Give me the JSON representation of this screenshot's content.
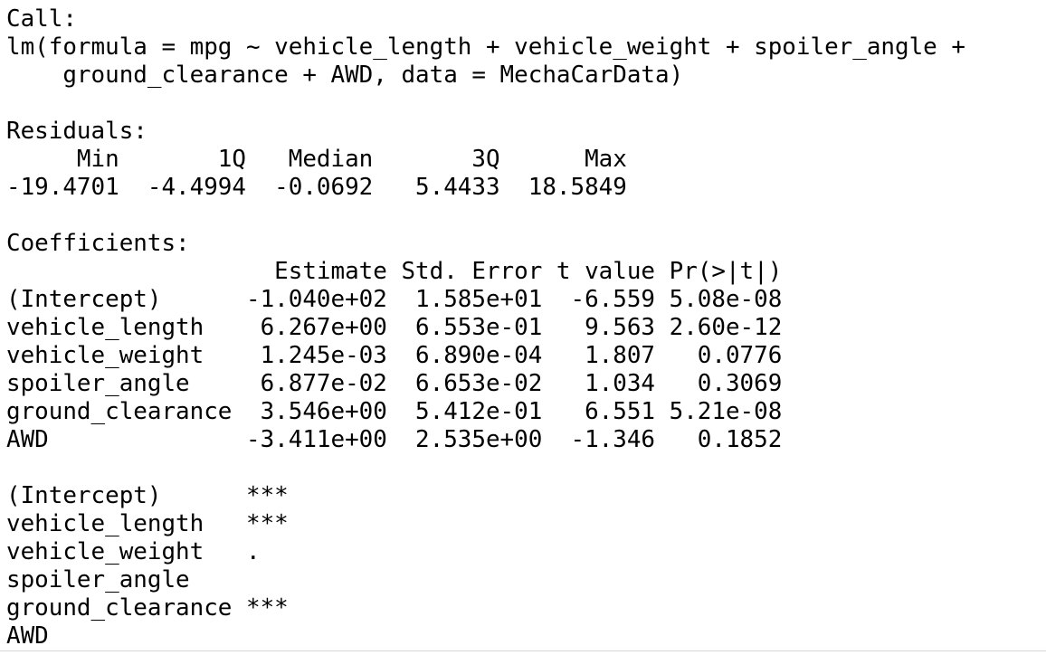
{
  "console": {
    "lines": [
      "Call:",
      "lm(formula = mpg ~ vehicle_length + vehicle_weight + spoiler_angle + ",
      "    ground_clearance + AWD, data = MechaCarData)",
      "",
      "Residuals:",
      "     Min       1Q   Median       3Q      Max ",
      "-19.4701  -4.4994  -0.0692   5.4433  18.5849 ",
      "",
      "Coefficients:",
      "                   Estimate Std. Error t value Pr(>|t|)",
      "(Intercept)      -1.040e+02  1.585e+01  -6.559 5.08e-08",
      "vehicle_length    6.267e+00  6.553e-01   9.563 2.60e-12",
      "vehicle_weight    1.245e-03  6.890e-04   1.807   0.0776",
      "spoiler_angle     6.877e-02  6.653e-02   1.034   0.3069",
      "ground_clearance  3.546e+00  5.412e-01   6.551 5.21e-08",
      "AWD              -3.411e+00  2.535e+00  -1.346   0.1852",
      "",
      "(Intercept)      ***",
      "vehicle_length   ***",
      "vehicle_weight   .  ",
      "spoiler_angle       ",
      "ground_clearance ***",
      "AWD                 "
    ]
  }
}
